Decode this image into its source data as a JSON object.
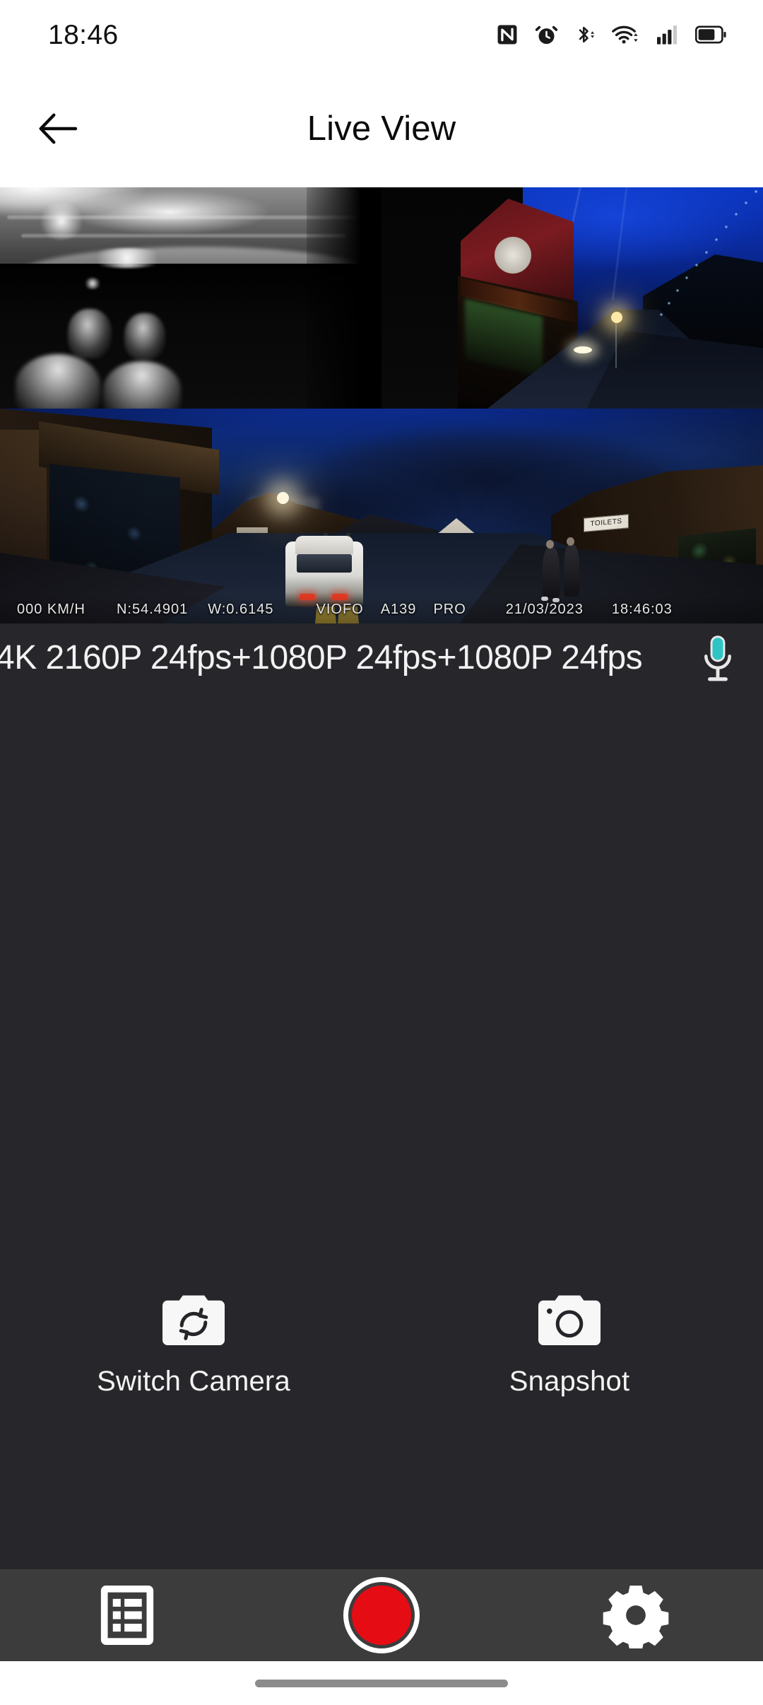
{
  "status_bar": {
    "time": "18:46",
    "icons": [
      {
        "name": "nfc-icon"
      },
      {
        "name": "alarm-clock-icon"
      },
      {
        "name": "bluetooth-icon"
      },
      {
        "name": "wifi-icon"
      },
      {
        "name": "cellular-signal-icon"
      },
      {
        "name": "battery-icon"
      }
    ]
  },
  "app_bar": {
    "back_label": "back-arrow-icon",
    "title": "Live View"
  },
  "video": {
    "osd": {
      "speed": "000 KM/H",
      "latitude": "N:54.4901",
      "longitude": "W:0.6145",
      "brand": "VIOFO",
      "model": "A139",
      "variant": "PRO",
      "date": "21/03/2023",
      "time": "18:46:03"
    },
    "panels": [
      {
        "name": "interior-ir-camera"
      },
      {
        "name": "front-camera-top"
      },
      {
        "name": "front-camera-main"
      }
    ],
    "scene_labels": {
      "toilets_sign": "TOILETS"
    }
  },
  "resolution_bar": {
    "resolution_text": "4K 2160P 24fps+1080P 24fps+1080P 24fps",
    "mic_icon": "microphone-icon",
    "mic_color": "#2ec4c4"
  },
  "actions": [
    {
      "icon": "switch-camera-icon",
      "label": "Switch Camera"
    },
    {
      "icon": "snapshot-camera-icon",
      "label": "Snapshot"
    }
  ],
  "bottom_nav": [
    {
      "icon": "file-list-icon",
      "name": "files"
    },
    {
      "icon": "record-button-icon",
      "name": "record"
    },
    {
      "icon": "settings-gear-icon",
      "name": "settings"
    }
  ],
  "colors": {
    "record_red": "#e60c14",
    "app_bg": "#27272b",
    "nav_bg": "#3c3c3c",
    "accent_teal": "#2ec4c4"
  }
}
